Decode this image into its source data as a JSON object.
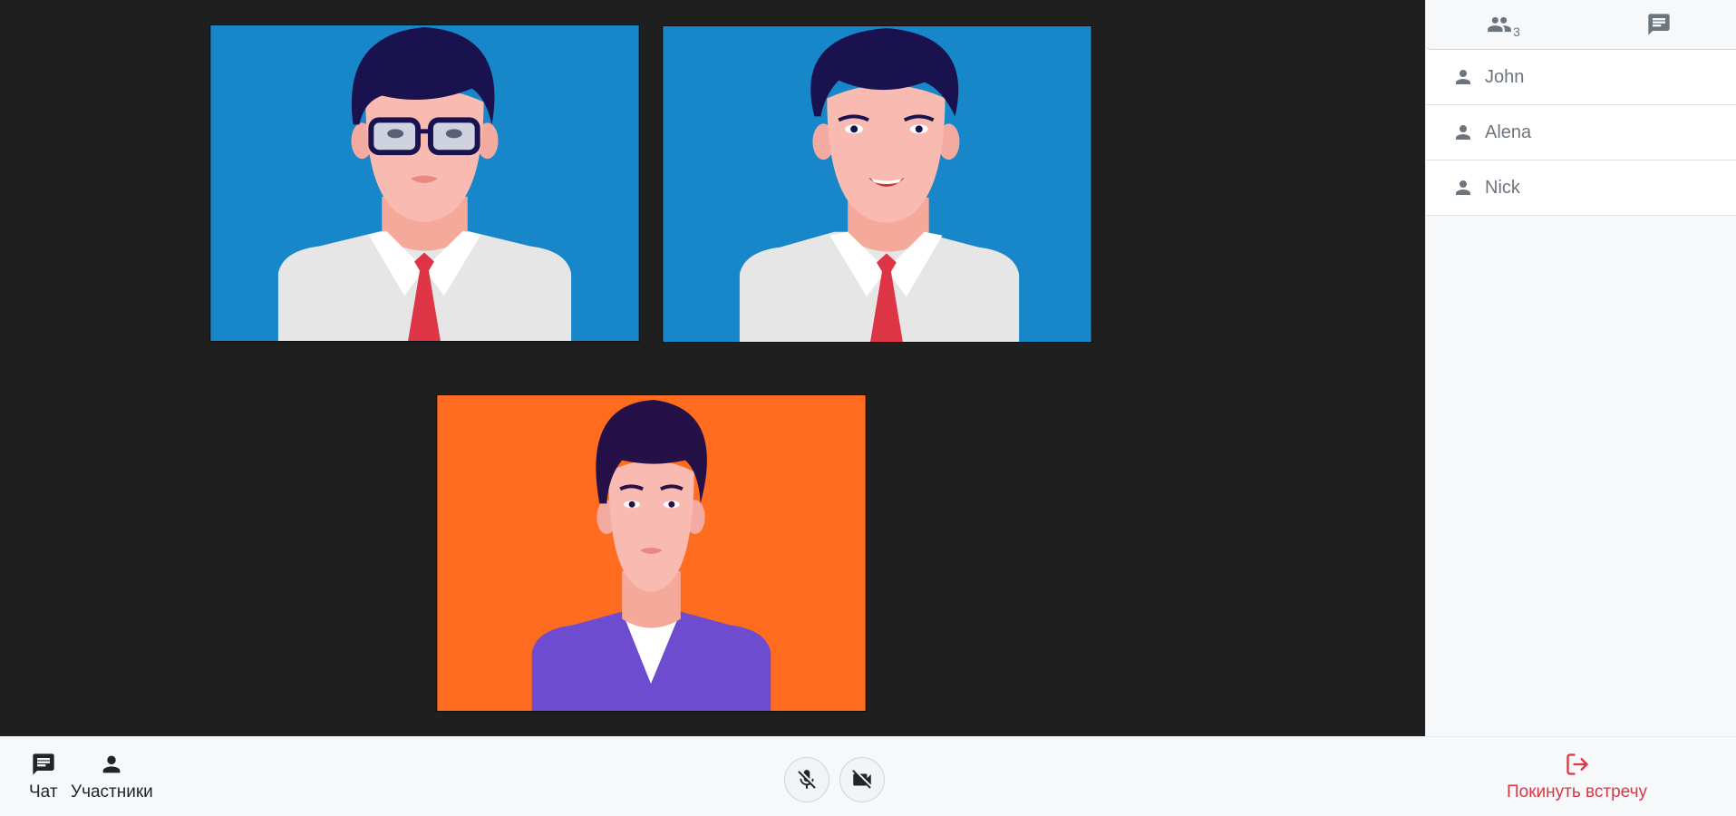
{
  "participants_tab": {
    "icon": "people-icon",
    "count": "3"
  },
  "chat_tab": {
    "icon": "chat-icon"
  },
  "participants": [
    {
      "name": "John",
      "icon": "person-icon"
    },
    {
      "name": "Alena",
      "icon": "person-icon"
    },
    {
      "name": "Nick",
      "icon": "person-icon"
    }
  ],
  "videos": [
    {
      "background": "#1787c9",
      "avatar": "man-with-glasses-white-shirt-red-tie"
    },
    {
      "background": "#1787c9",
      "avatar": "smiling-man-white-shirt-red-tie"
    },
    {
      "background": "#ff6c1f",
      "avatar": "man-purple-sweater"
    }
  ],
  "toolbar": {
    "chat_label": "Чат",
    "participants_label": "Участники",
    "mic_icon": "mic-off-icon",
    "camera_icon": "video-off-icon",
    "leave_label": "Покинуть встречу"
  },
  "colors": {
    "stage": "#201f1f",
    "leave": "#dc3545",
    "muted_text": "#6c757d"
  }
}
